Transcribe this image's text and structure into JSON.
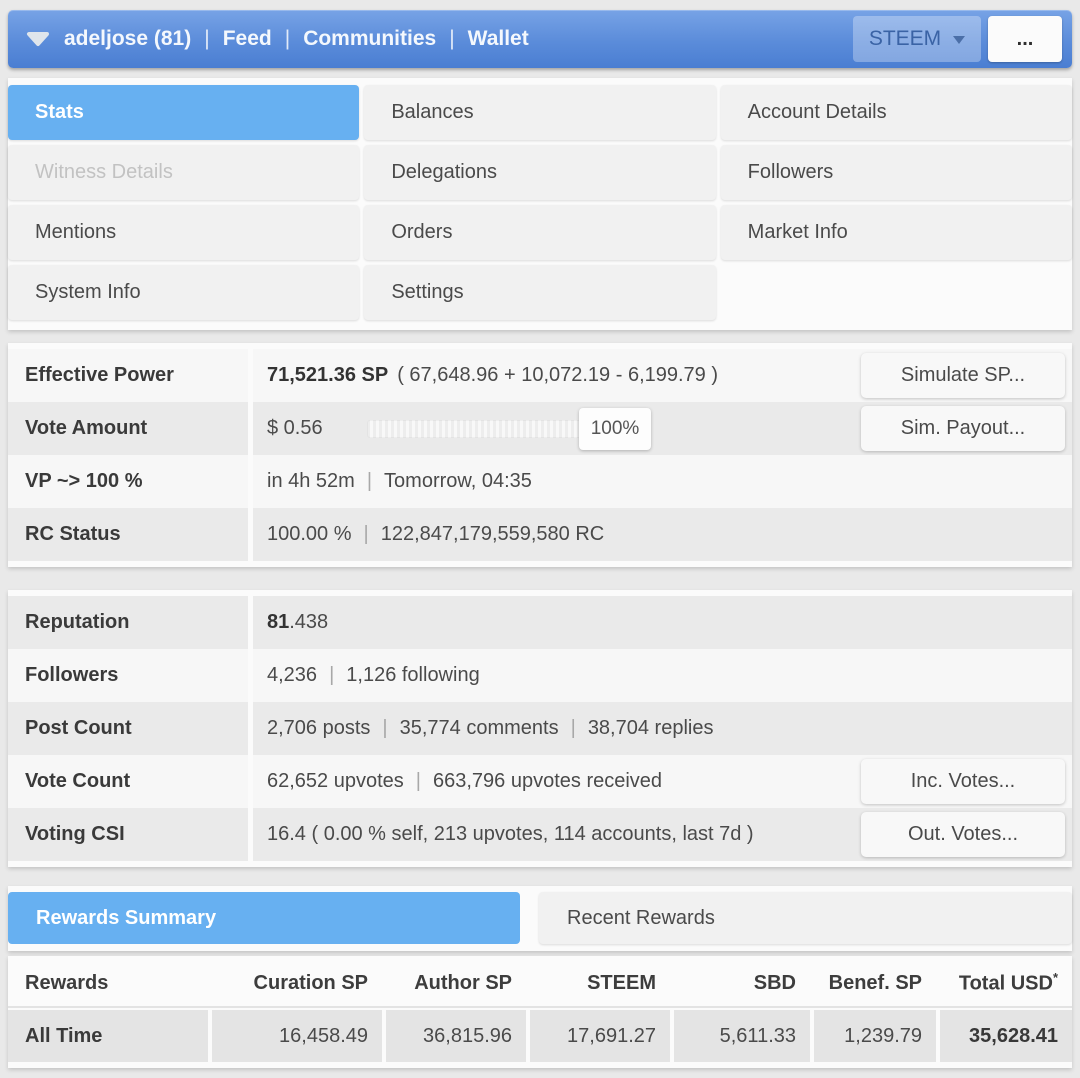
{
  "ui": {
    "separator": "|",
    "colors": {
      "accent": "#67b0f1",
      "header-top": "#77a3e6",
      "header-bottom": "#4a7ed2",
      "active-text": "#ffffff"
    }
  },
  "header": {
    "username": "adeljose (81)",
    "nav": [
      "Feed",
      "Communities",
      "Wallet"
    ],
    "steem_label": "STEEM",
    "more_label": "..."
  },
  "tabs": {
    "items": [
      {
        "label": "Stats"
      },
      {
        "label": "Balances"
      },
      {
        "label": "Account Details"
      },
      {
        "label": "Witness Details"
      },
      {
        "label": "Delegations"
      },
      {
        "label": "Followers"
      },
      {
        "label": "Mentions"
      },
      {
        "label": "Orders"
      },
      {
        "label": "Market Info"
      },
      {
        "label": "System Info"
      },
      {
        "label": "Settings"
      }
    ]
  },
  "stats_power": {
    "rows": [
      {
        "label": "Effective Power",
        "value_bold": "71,521.36 SP",
        "value_detail": "( 67,648.96 + 10,072.19 - 6,199.79 )",
        "button": "Simulate SP..."
      },
      {
        "label": "Vote Amount",
        "amount": "$ 0.56",
        "percent": "100%",
        "button": "Sim. Payout..."
      },
      {
        "label": "VP ~> 100 %",
        "parts": [
          "in 4h 52m",
          "Tomorrow, 04:35"
        ]
      },
      {
        "label": "RC Status",
        "parts": [
          "100.00 %",
          "122,847,179,559,580 RC"
        ]
      }
    ]
  },
  "stats_account": {
    "rows": [
      {
        "label": "Reputation",
        "value_bold": "81",
        "value_rest": ".438"
      },
      {
        "label": "Followers",
        "parts": [
          "4,236",
          "1,126 following"
        ]
      },
      {
        "label": "Post Count",
        "parts": [
          "2,706 posts",
          "35,774 comments",
          "38,704 replies"
        ]
      },
      {
        "label": "Vote Count",
        "parts": [
          "62,652 upvotes",
          "663,796 upvotes received"
        ],
        "button": "Inc. Votes..."
      },
      {
        "label": "Voting CSI",
        "value": "16.4 ( 0.00 % self, 213 upvotes, 114 accounts, last 7d )",
        "button": "Out. Votes..."
      }
    ]
  },
  "rewards": {
    "tabs": [
      {
        "label": "Rewards Summary"
      },
      {
        "label": "Recent Rewards"
      }
    ],
    "table": {
      "columns": [
        "Rewards",
        "Curation SP",
        "Author SP",
        "STEEM",
        "SBD",
        "Benef. SP",
        "Total USD"
      ],
      "footnote_marker": "*",
      "rows": [
        {
          "label": "All Time",
          "values": [
            "16,458.49",
            "36,815.96",
            "17,691.27",
            "5,611.33",
            "1,239.79",
            "35,628.41"
          ]
        }
      ]
    }
  }
}
